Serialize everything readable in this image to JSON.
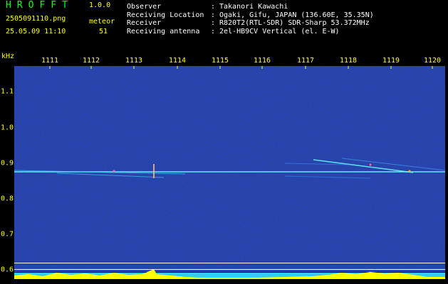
{
  "header": {
    "app_name": "HROFFT",
    "app_version": "1.0.0",
    "filename": "2505091110.png",
    "datetime": "25.05.09 11:10",
    "meteor_label": "meteor",
    "meteor_count": "51"
  },
  "info": [
    {
      "key": "Observer",
      "sep": ":",
      "value": "Takanori Kawachi"
    },
    {
      "key": "Receiving Location",
      "sep": ":",
      "value": "Ogaki, Gifu, JAPAN (136.60E, 35.35N)"
    },
    {
      "key": "Receiver",
      "sep": ":",
      "value": "R820T2(RTL-SDR) SDR-Sharp 53.372MHz"
    },
    {
      "key": "Receiving antenna",
      "sep": ":",
      "value": "2el-HB9CV Vertical (el. E-W)"
    }
  ],
  "axes": {
    "y_unit": "kHz",
    "x_ticks": [
      "1111",
      "1112",
      "1113",
      "1114",
      "1115",
      "1116",
      "1117",
      "1118",
      "1119",
      "1120"
    ],
    "y_ticks": [
      "1.1",
      "1.0",
      "0.9",
      "0.8",
      "0.7",
      "0.6"
    ]
  },
  "colors": {
    "background": "#000000",
    "title_green": "#00ff00",
    "label_yellow": "#ffff00",
    "info_white": "#ffffff",
    "noise_blue": "#0a1a8a",
    "carrier_cyan": "#66ffff",
    "level_yellow": "#ffff00"
  }
}
